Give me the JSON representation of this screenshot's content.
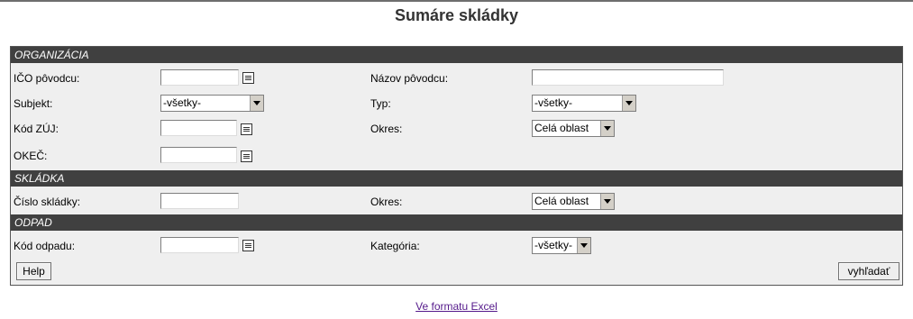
{
  "page": {
    "title": "Sumáre skládky"
  },
  "sections": {
    "organizacia": {
      "header": "ORGANIZÁCIA",
      "ico_label": "IČO pôvodcu:",
      "nazov_label": "Názov pôvodcu:",
      "subjekt_label": "Subjekt:",
      "subjekt_value": "-všetky-",
      "typ_label": "Typ:",
      "typ_value": "-všetky-",
      "kod_zuj_label": "Kód ZÚJ:",
      "okres_label": "Okres:",
      "okres_value": "Celá oblast",
      "okec_label": "OKEČ:"
    },
    "skladka": {
      "header": "SKLÁDKA",
      "cislo_label": "Číslo skládky:",
      "okres_label": "Okres:",
      "okres_value": "Celá oblast"
    },
    "odpad": {
      "header": "ODPAD",
      "kod_label": "Kód odpadu:",
      "kategoria_label": "Kategória:",
      "kategoria_value": "-všetky-"
    }
  },
  "buttons": {
    "help": "Help",
    "search": "vyhľadať"
  },
  "footer": {
    "excel_link": "Ve formatu Excel"
  }
}
